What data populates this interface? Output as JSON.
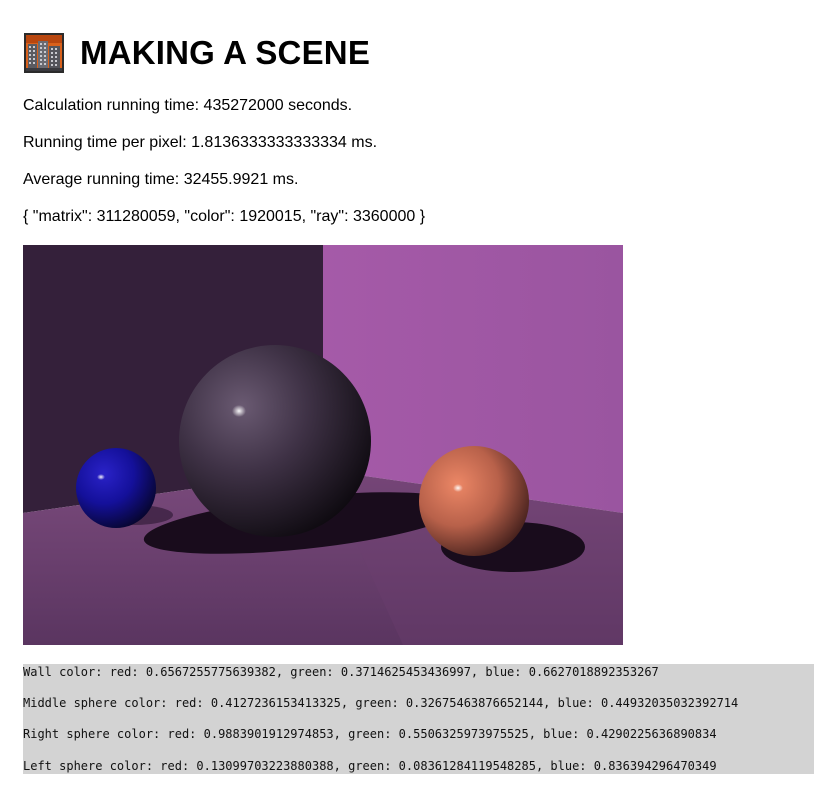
{
  "header": {
    "title": "MAKING A SCENE",
    "logo_icon": "building-icon"
  },
  "stats": {
    "calculation_time": "Calculation running time: 435272000 seconds.",
    "time_per_pixel": "Running time per pixel: 1.8136333333333334 ms.",
    "average_time": "Average running time: 32455.9921 ms.",
    "counts": "{ \"matrix\": 311280059, \"color\": 1920015, \"ray\": 3360000 }"
  },
  "scene": {
    "wall_color_hex": "#a75fa9",
    "middle_sphere_hex": "#695373",
    "right_sphere_hex": "#fc8c6d",
    "left_sphere_hex": "#2115d5"
  },
  "colors": {
    "wall": "Wall color: red: 0.6567255775639382, green: 0.3714625453436997, blue: 0.6627018892353267",
    "middle": "Middle sphere color: red: 0.4127236153413325, green: 0.32675463876652144, blue: 0.44932035032392714",
    "right": "Right sphere color: red: 0.9883901912974853, green: 0.5506325973975525, blue: 0.4290225636890834",
    "left": "Left sphere color: red: 0.13099703223880388, green: 0.08361284119548285, blue: 0.836394296470349"
  }
}
